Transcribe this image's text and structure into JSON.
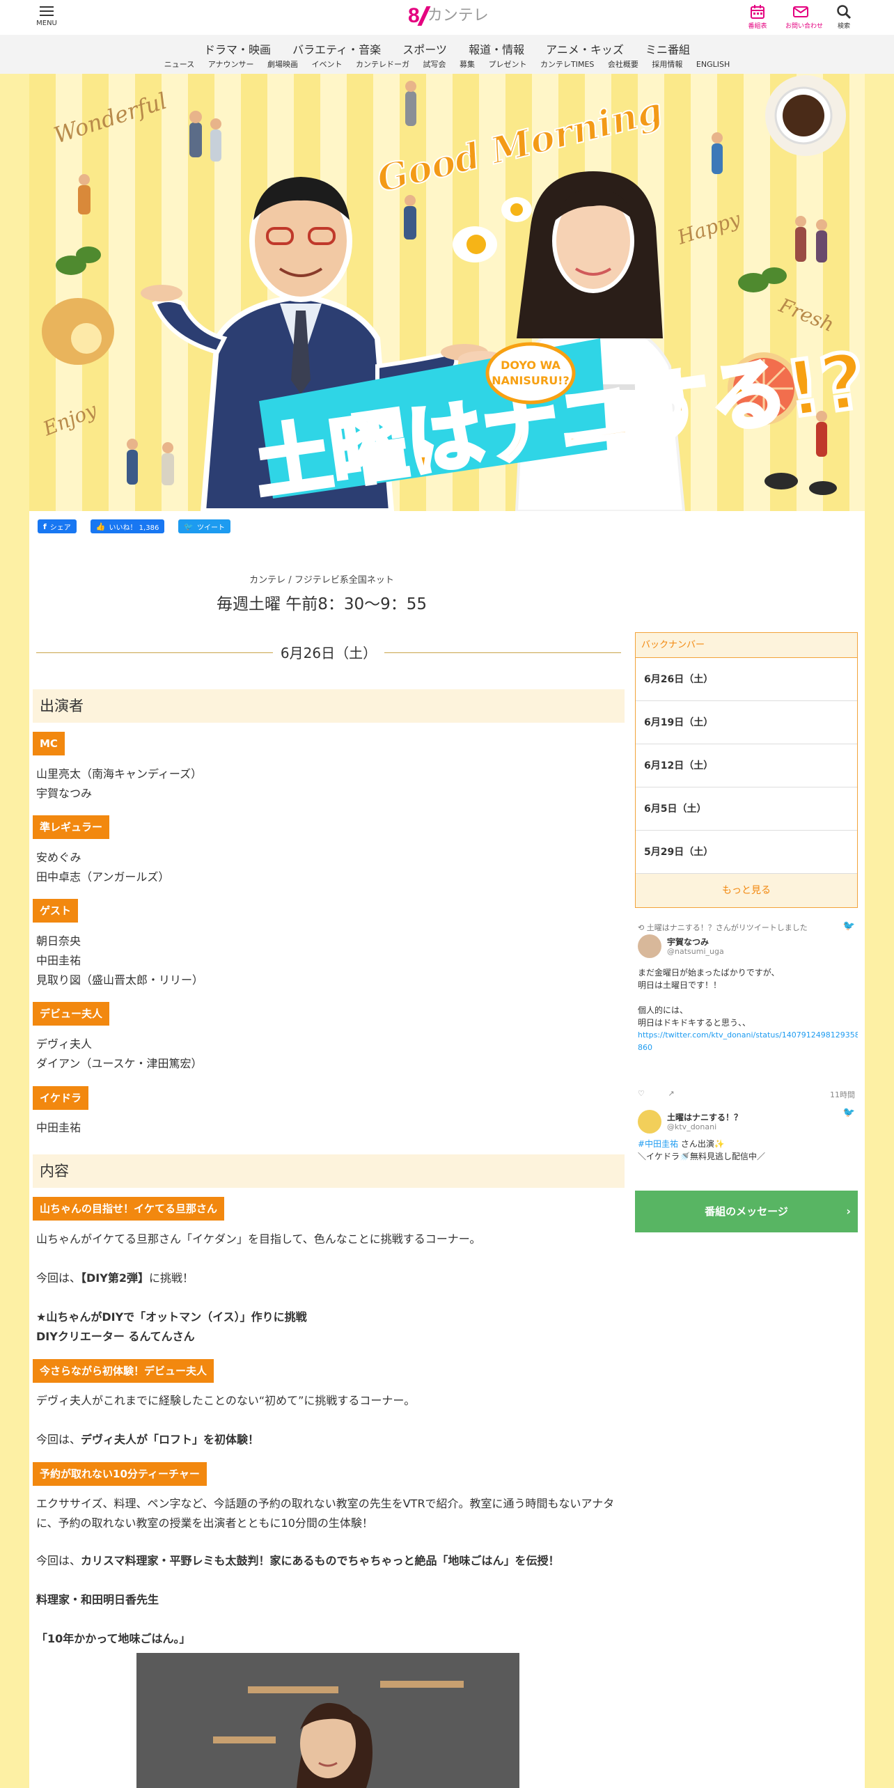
{
  "header": {
    "menu_label": "MENU",
    "logo_mark": "8",
    "logo_text": "カンテレ",
    "icons": {
      "schedule": "番組表",
      "contact": "お問い合わせ",
      "search": "検索"
    }
  },
  "nav": {
    "main": [
      "ドラマ・映画",
      "バラエティ・音楽",
      "スポーツ",
      "報道・情報",
      "アニメ・キッズ",
      "ミニ番組"
    ],
    "sub": [
      "ニュース",
      "アナウンサー",
      "劇場映画",
      "イベント",
      "カンテレドーガ",
      "試写会",
      "募集",
      "プレゼント",
      "カンテレTIMES",
      "会社概要",
      "採用情報",
      "ENGLISH"
    ]
  },
  "hero": {
    "good_morning": "Good Morning",
    "wonderful": "Wonderful",
    "happy": "Happy",
    "fresh": "Fresh",
    "enjoy": "Enjoy",
    "title": "土曜はナニする!?",
    "badge_line1": "DOYO WA",
    "badge_line2": "NANISURU!?"
  },
  "social": {
    "share": "シェア",
    "like": "いいね！ 1,386",
    "tweet": "ツイート"
  },
  "program": {
    "network": "カンテレ / フジテレビ系全国ネット",
    "broadcast": "毎週土曜 午前8：30～9：55",
    "date": "6月26日（土）"
  },
  "cast": {
    "heading": "出演者",
    "groups": [
      {
        "tag": "MC",
        "names": [
          "山里亮太（南海キャンディーズ）",
          "宇賀なつみ"
        ]
      },
      {
        "tag": "準レギュラー",
        "names": [
          "安めぐみ",
          "田中卓志（アンガールズ）"
        ]
      },
      {
        "tag": "ゲスト",
        "names": [
          "朝日奈央",
          "中田圭祐",
          "見取り図（盛山晋太郎・リリー）"
        ]
      },
      {
        "tag": "デビュー夫人",
        "names": [
          "デヴィ夫人",
          "ダイアン（ユースケ・津田篤宏）"
        ]
      },
      {
        "tag": "イケドラ",
        "names": [
          "中田圭祐"
        ]
      }
    ]
  },
  "content": {
    "heading": "内容",
    "c1_tag": "山ちゃんの目指せ！イケてる旦那さん",
    "c1_desc": "山ちゃんがイケてる旦那さん「イケダン」を目指して、色んなことに挑戦するコーナー。",
    "c1_today_prefix": "今回は、",
    "c1_today_bold": "【DIY第2弾】",
    "c1_today_suffix": "に挑戦！",
    "c1_line1": "★山ちゃんがDIYで「オットマン（イス）」作りに挑戦",
    "c1_line2": "DIYクリエーター るんてんさん",
    "c2_tag": "今さらながら初体験！デビュー夫人",
    "c2_desc": "デヴィ夫人がこれまでに経験したことのない“初めて”に挑戦するコーナー。",
    "c2_today_prefix": "今回は、",
    "c2_today_bold": "デヴィ夫人が「ロフト」を初体験！",
    "c3_tag": "予約が取れない10分ティーチャー",
    "c3_desc": "エクササイズ、料理、ペン字など、今話題の予約の取れない教室の先生をVTRで紹介。教室に通う時間もないアナタに、予約の取れない教室の授業を出演者とともに10分間の生体験！",
    "c3_today_prefix": "今回は、",
    "c3_today_bold": "カリスマ料理家・平野レミも太鼓判！家にあるものでちゃちゃっと絶品「地味ごはん」を伝授！",
    "c3_teacher": "料理家・和田明日香先生",
    "c3_book": "「10年かかって地味ごはん。」"
  },
  "sidebar": {
    "backnumber_title": "バックナンバー",
    "backnumbers": [
      "6月26日（土）",
      "6月19日（土）",
      "6月12日（土）",
      "6月5日（土）",
      "5月29日（土）"
    ],
    "more": "もっと見る",
    "tweet1": {
      "retweet": "土曜はナニする！？さんがリツイートしました",
      "name": "宇賀なつみ",
      "handle": "@natsumi_uga",
      "line1": "まだ金曜日が始まったばかりですが、",
      "line2": "明日は土曜日です！！",
      "line3": "個人的には、",
      "line4": "明日はドキドキすると思う、、",
      "link1": "https://twitter.com/ktv_donani/status/1407912498129358",
      "link2": "860",
      "time": "11時間"
    },
    "tweet2": {
      "name": "土曜はナニする！？",
      "handle": "@ktv_donani",
      "line1_tag": "#中田圭祐",
      "line1": " さん出演✨",
      "line2": "＼イケドラ🚿無料見逃し配信中／"
    },
    "message_button": "番組のメッセージ"
  },
  "colors": {
    "brand": "#e4007f",
    "tag_orange": "#f2880f",
    "section_bg": "#fdf3dc",
    "message_green": "#58b563",
    "page_bg": "#fdf0a4"
  }
}
